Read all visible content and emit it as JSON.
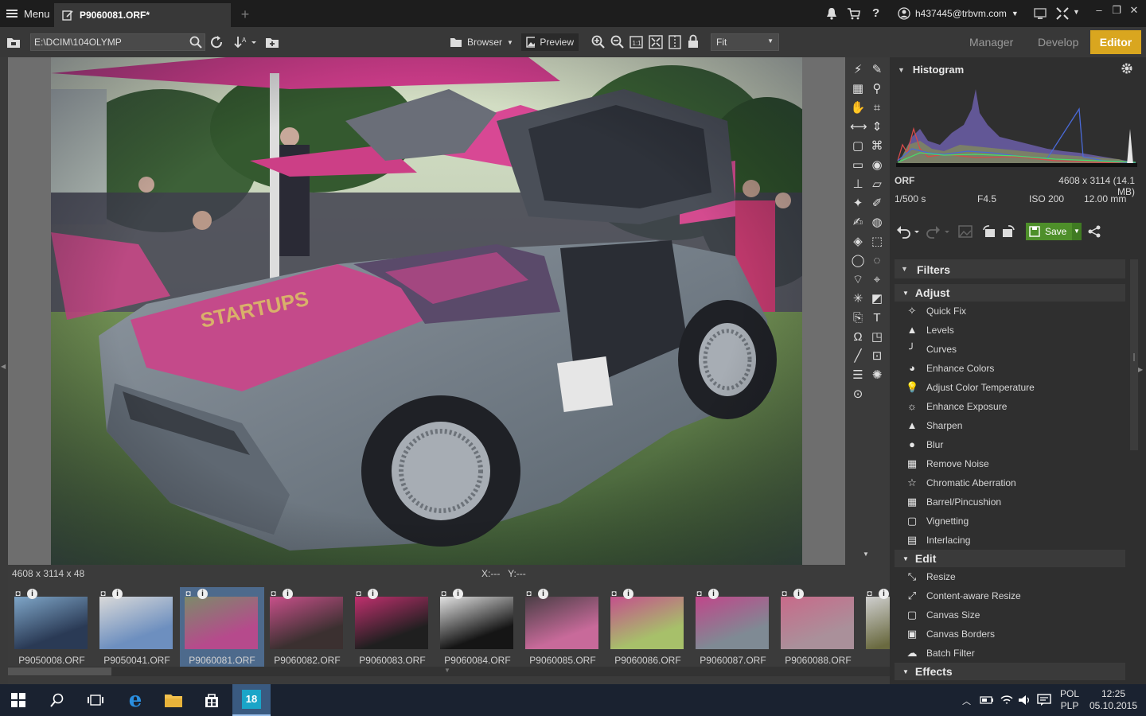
{
  "titlebar": {
    "menu_label": "Menu",
    "tab_title": "P9060081.ORF*",
    "account_email": "h437445@trbvm.com"
  },
  "toolbar": {
    "path": "E:\\DCIM\\104OLYMP",
    "browser_label": "Browser",
    "preview_label": "Preview",
    "zoom_select": "Fit",
    "modes": {
      "manager": "Manager",
      "develop": "Develop",
      "editor": "Editor"
    }
  },
  "status": {
    "dimensions": "4608 x 3114 x 48",
    "coords": "X:---   Y:---"
  },
  "filmstrip": [
    {
      "name": "P9050008.ORF"
    },
    {
      "name": "P9050041.ORF"
    },
    {
      "name": "P9060081.ORF"
    },
    {
      "name": "P9060082.ORF"
    },
    {
      "name": "P9060083.ORF"
    },
    {
      "name": "P9060084.ORF"
    },
    {
      "name": "P9060085.ORF"
    },
    {
      "name": "P9060086.ORF"
    },
    {
      "name": "P9060087.ORF"
    },
    {
      "name": "P9060088.ORF"
    },
    {
      "name": "P91"
    }
  ],
  "panel": {
    "histogram_title": "Histogram",
    "format": "ORF",
    "size": "4608 x 3114 (14.1 MB)",
    "shutter": "1/500 s",
    "aperture": "F4.5",
    "iso": "ISO 200",
    "focal": "12.00 mm",
    "save_label": "Save",
    "filters_title": "Filters",
    "adjust_title": "Adjust",
    "adjust_items": [
      "Quick Fix",
      "Levels",
      "Curves",
      "Enhance Colors",
      "Adjust Color Temperature",
      "Enhance Exposure",
      "Sharpen",
      "Blur",
      "Remove Noise",
      "Chromatic Aberration",
      "Barrel/Pincushion",
      "Vignetting",
      "Interlacing"
    ],
    "edit_title": "Edit",
    "edit_items": [
      "Resize",
      "Content-aware Resize",
      "Canvas Size",
      "Canvas  Borders",
      "Batch Filter"
    ],
    "effects_title": "Effects"
  },
  "taskbar": {
    "lang_top": "POL",
    "lang_bottom": "PLP",
    "time": "12:25",
    "date": "05.10.2015"
  },
  "colors": {
    "accent": "#d9a61f",
    "selection": "#4d6a8c",
    "save_green": "#4e8f2a"
  }
}
